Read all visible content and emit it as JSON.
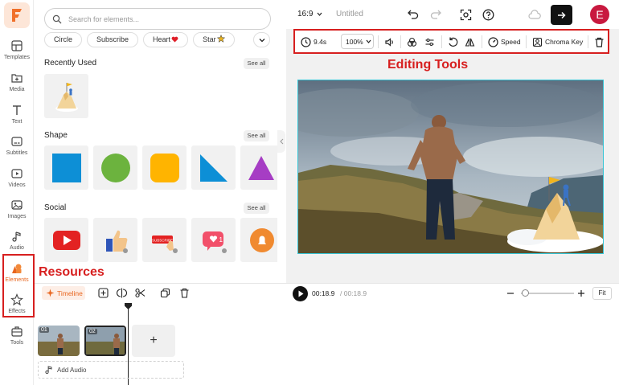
{
  "left_rail": {
    "items": [
      {
        "label": "Templates",
        "icon": "templates-icon"
      },
      {
        "label": "Media",
        "icon": "media-icon"
      },
      {
        "label": "Text",
        "icon": "text-icon"
      },
      {
        "label": "Subtitles",
        "icon": "subtitles-icon"
      },
      {
        "label": "Videos",
        "icon": "videos-icon"
      },
      {
        "label": "Images",
        "icon": "images-icon"
      },
      {
        "label": "Audio",
        "icon": "audio-icon"
      },
      {
        "label": "Elements",
        "icon": "elements-icon",
        "active": true
      },
      {
        "label": "Effects",
        "icon": "effects-icon"
      },
      {
        "label": "Tools",
        "icon": "tools-icon"
      }
    ]
  },
  "elements_panel": {
    "search_placeholder": "Search for elements...",
    "chips": [
      "Circle",
      "Subscribe",
      "Heart",
      "Star"
    ],
    "sections": {
      "recently_used": {
        "title": "Recently Used",
        "see_all": "See all"
      },
      "shape": {
        "title": "Shape",
        "see_all": "See all"
      },
      "social": {
        "title": "Social",
        "see_all": "See all"
      }
    }
  },
  "topbar": {
    "aspect_ratio": "16:9",
    "project_title": "Untitled",
    "avatar_letter": "E"
  },
  "editing_toolbar": {
    "duration": "9.4s",
    "zoom": "100%",
    "speed_label": "Speed",
    "chroma_key_label": "Chroma Key"
  },
  "annotations": {
    "editing_tools": "Editing Tools",
    "resources": "Resources"
  },
  "timeline": {
    "label": "Timeline",
    "current_time": "00:18.9",
    "total_time": "/ 00:18.9",
    "fit_label": "Fit",
    "add_audio_label": "Add Audio",
    "clips": [
      {
        "number": "01"
      },
      {
        "number": "02"
      }
    ],
    "add_clip_symbol": "+"
  },
  "colors": {
    "accent": "#e8661f",
    "annotation_red": "#d71f1f",
    "canvas_border": "#36c5d6"
  }
}
